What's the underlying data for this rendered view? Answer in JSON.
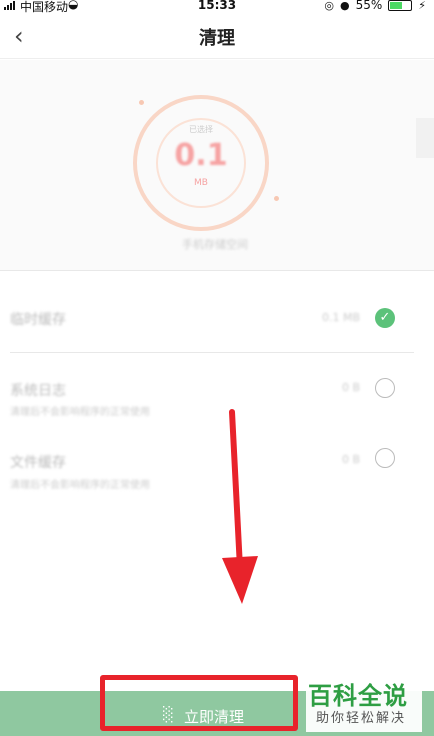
{
  "status_bar": {
    "carrier": "中国移动",
    "time": "15:33",
    "battery": "55%"
  },
  "nav": {
    "back_icon": "chevron-left",
    "title": "清理"
  },
  "summary": {
    "label": "已选择",
    "value": "0.1",
    "unit": "MB",
    "caption": "手机存储空间"
  },
  "items": [
    {
      "title": "临时缓存",
      "description": "",
      "size": "0.1 MB",
      "checked": true
    },
    {
      "title": "系统日志",
      "description": "清理后不会影响程序的正常使用",
      "size": "0 B",
      "checked": false
    },
    {
      "title": "文件缓存",
      "description": "清理后不会影响程序的正常使用",
      "size": "0 B",
      "checked": false
    }
  ],
  "action": {
    "clean_label": "立即清理",
    "icon": "broom-icon"
  },
  "watermark": {
    "main": "百科全说",
    "sub": "助你轻松解决"
  },
  "colors": {
    "accent_green": "#5cc27a",
    "button_green": "#8fc8a0",
    "annotation_red": "#e8232b",
    "ring": "#f9d6c6"
  }
}
